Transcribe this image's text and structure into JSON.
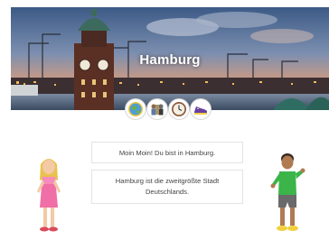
{
  "header": {
    "title": "Hamburg"
  },
  "icons": [
    {
      "name": "globe-icon"
    },
    {
      "name": "people-icon"
    },
    {
      "name": "clock-icon"
    },
    {
      "name": "shoe-icon"
    }
  ],
  "dialog": {
    "line1": "Moin Moin! Du bist in Hamburg.",
    "line2": "Hamburg ist die zweitgrößte Stadt Deutschlands."
  }
}
